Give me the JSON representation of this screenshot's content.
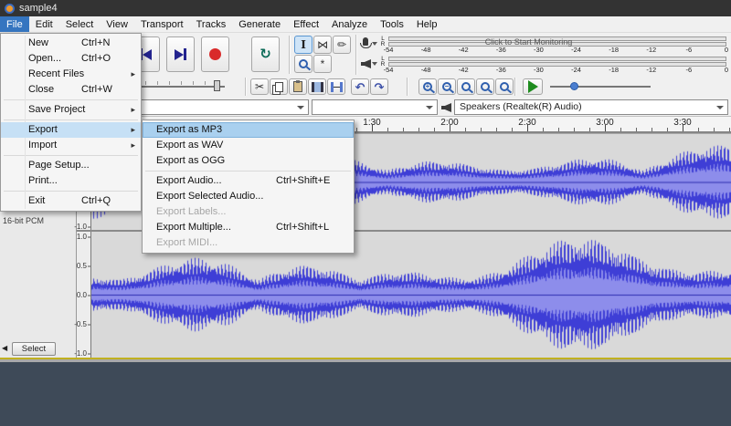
{
  "titlebar": {
    "title": "sample4"
  },
  "menubar": {
    "items": [
      "File",
      "Edit",
      "Select",
      "View",
      "Transport",
      "Tracks",
      "Generate",
      "Effect",
      "Analyze",
      "Tools",
      "Help"
    ],
    "active_index": 0
  },
  "file_menu": {
    "items": [
      {
        "label": "New",
        "shortcut": "Ctrl+N"
      },
      {
        "label": "Open...",
        "shortcut": "Ctrl+O"
      },
      {
        "label": "Recent Files",
        "submenu": true
      },
      {
        "label": "Close",
        "shortcut": "Ctrl+W"
      },
      {
        "type": "separator"
      },
      {
        "label": "Save Project",
        "submenu": true
      },
      {
        "type": "separator"
      },
      {
        "label": "Export",
        "submenu": true,
        "state": "open"
      },
      {
        "label": "Import",
        "submenu": true
      },
      {
        "type": "separator"
      },
      {
        "label": "Page Setup..."
      },
      {
        "label": "Print..."
      },
      {
        "type": "separator"
      },
      {
        "label": "Exit",
        "shortcut": "Ctrl+Q"
      }
    ]
  },
  "export_submenu": {
    "items": [
      {
        "label": "Export as MP3",
        "state": "highlighted"
      },
      {
        "label": "Export as WAV"
      },
      {
        "label": "Export as OGG"
      },
      {
        "type": "separator"
      },
      {
        "label": "Export Audio...",
        "shortcut": "Ctrl+Shift+E"
      },
      {
        "label": "Export Selected Audio..."
      },
      {
        "label": "Export Labels...",
        "disabled": true
      },
      {
        "label": "Export Multiple...",
        "shortcut": "Ctrl+Shift+L"
      },
      {
        "label": "Export MIDI...",
        "disabled": true
      }
    ]
  },
  "meters": {
    "record": {
      "channel_labels": [
        "L",
        "R"
      ],
      "scale": [
        "-54",
        "-48",
        "-42",
        "-36",
        "-30",
        "-24",
        "-18",
        "-12",
        "-6",
        "0"
      ],
      "status_text": "Click to Start Monitoring"
    },
    "playback": {
      "channel_labels": [
        "L",
        "R"
      ],
      "scale": [
        "-54",
        "-48",
        "-42",
        "-36",
        "-30",
        "-24",
        "-18",
        "-12",
        "-6",
        "0"
      ]
    }
  },
  "device_toolbar": {
    "recording_device": "",
    "recording_channels": "",
    "playback_device": "Speakers (Realtek(R) Audio)"
  },
  "timeline": {
    "labels": [
      "1:30",
      "2:00",
      "2:30",
      "3:00",
      "3:30"
    ]
  },
  "track": {
    "format": "16-bit PCM",
    "select_button": "Select",
    "channel_scale": [
      "1.0",
      "0.5",
      "0.0",
      "-0.5",
      "-1.0"
    ]
  },
  "icons": {
    "cut": "✂",
    "draw": "✏",
    "selection": "I",
    "envelope": "⋈",
    "multi": "*",
    "loop": "↻",
    "undo": "↶",
    "redo": "↷",
    "zoom_in": "+",
    "zoom_out": "−",
    "submenu_arrow": "▸",
    "collapse_track": "◀"
  },
  "colors": {
    "waveform": "#3e3ed6",
    "waveform_inner": "#8d8deb",
    "waveform_center": "#2d2db0",
    "waveform_bg": "#d9d9d9",
    "menu_highlight": "#a9d0ef",
    "active_menu": "#3575c0"
  }
}
